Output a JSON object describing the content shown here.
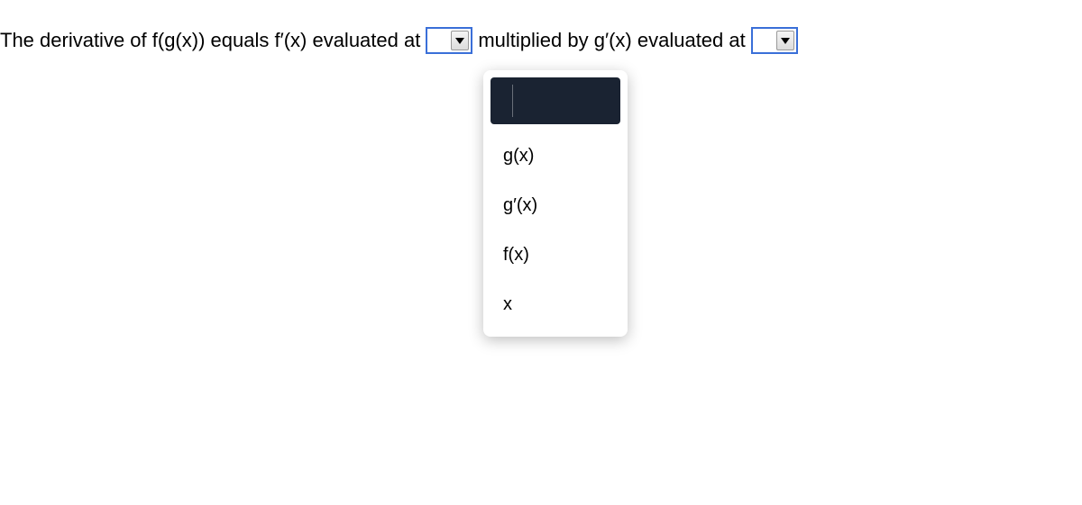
{
  "sentence": {
    "part1": "The derivative of f(g(x)) equals f′(x) evaluated at",
    "part2": "multiplied by g′(x) evaluated at"
  },
  "dropdown1": {
    "selected": "",
    "options": [
      "",
      "g(x)",
      "g′(x)",
      "f(x)",
      "x"
    ]
  },
  "dropdown2": {
    "selected": ""
  }
}
